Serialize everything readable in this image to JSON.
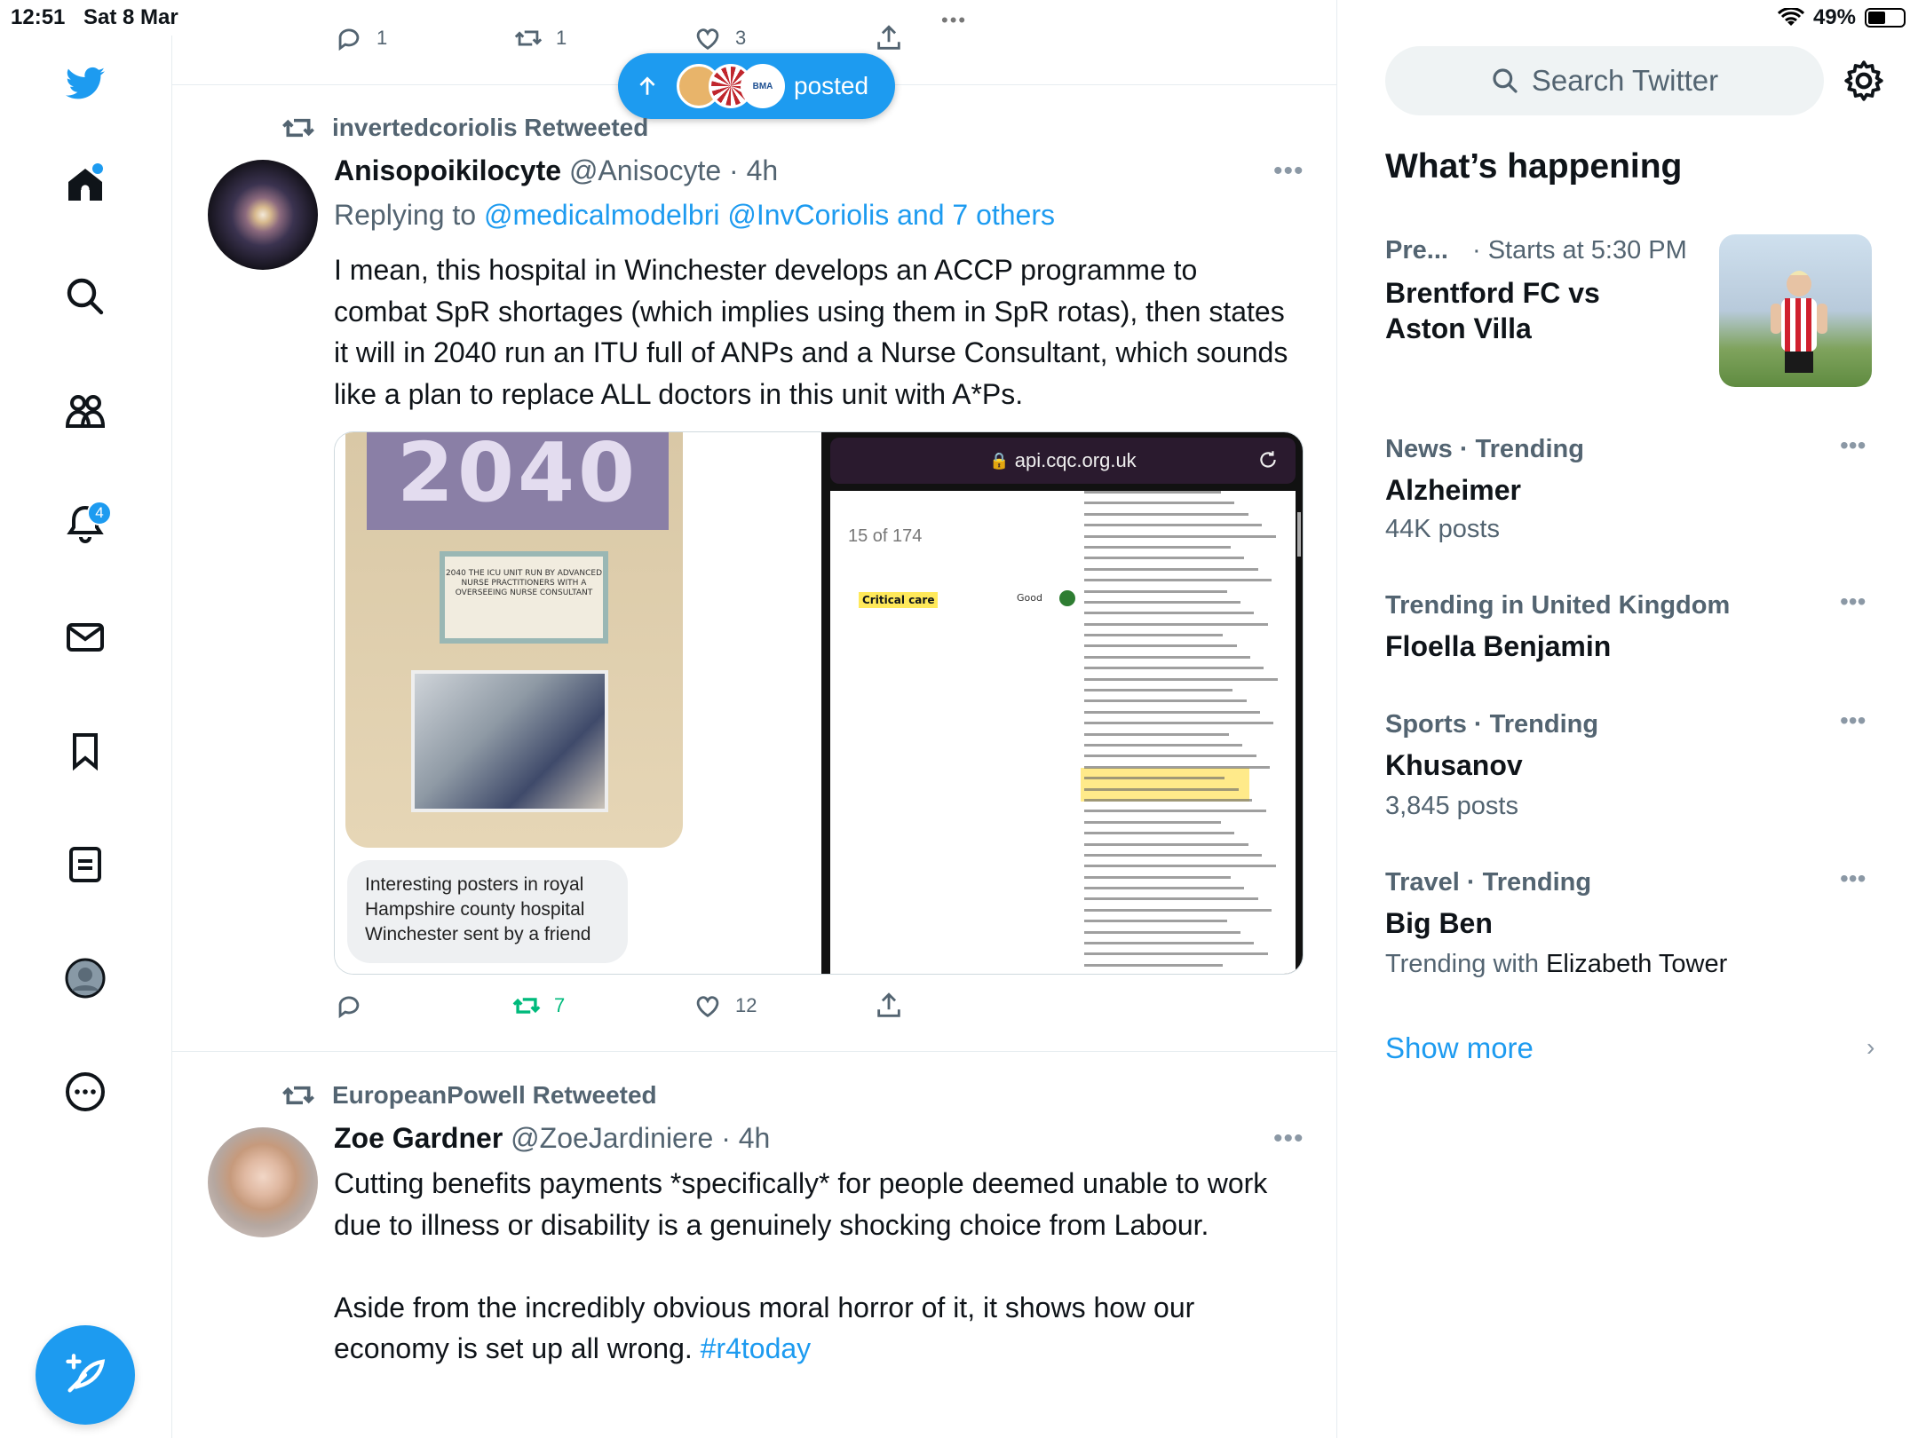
{
  "status_bar": {
    "time": "12:51",
    "date": "Sat 8 Mar",
    "battery": "49%"
  },
  "nav": {
    "notifications_badge": "4",
    "icons": [
      "twitter-logo-icon",
      "home-icon",
      "search-icon",
      "communities-icon",
      "bell-icon",
      "mail-icon",
      "bookmark-icon",
      "lists-icon",
      "profile-icon",
      "more-icon"
    ]
  },
  "timeline": {
    "prev_tweet_counts": {
      "replies": "1",
      "retweets": "1",
      "likes": "3"
    },
    "new_posts_pill": {
      "label": "posted",
      "avatar_badge": "BMA"
    },
    "tweet1": {
      "retweeted_by": "invertedcoriolis Retweeted",
      "name": "Anisopoikilocyte",
      "handle": "@Anisocyte",
      "time": "· 4h",
      "replying_prefix": "Replying to",
      "replying_links": "@medicalmodelbri @InvCoriolis and 7 others",
      "text": "I mean, this hospital in Winchester develops an ACCP programme to combat SpR shortages (which implies using them in SpR rotas), then states it will in 2040 run an ITU full of ANPs and a Nurse Consultant, which sounds like a plan to replace ALL doctors in this unit with A*Ps.",
      "media": {
        "poster_year": "2040",
        "poster_card_text": "2040 THE ICU UNIT RUN BY ADVANCED NURSE PRACTITIONERS WITH A OVERSEEING NURSE CONSULTANT",
        "caption": "Interesting posters in royal Hampshire county hospital Winchester sent by a friend",
        "url": "api.cqc.org.uk",
        "page_counter": "15 of 174",
        "doc_label": "Critical care",
        "doc_rating": "Good"
      },
      "counts": {
        "replies": "",
        "retweets": "7",
        "likes": "12"
      }
    },
    "tweet2": {
      "retweeted_by": "EuropeanPowell Retweeted",
      "name": "Zoe Gardner",
      "handle": "@ZoeJardiniere",
      "time": "· 4h",
      "text_p1": "Cutting benefits payments *specifically* for people deemed unable to work due to illness or disability is a genuinely shocking choice from Labour.",
      "text_p2": "Aside from the incredibly obvious moral horror of it, it shows how our economy is set up all wrong. ",
      "hashtag": "#r4today"
    }
  },
  "sidebar": {
    "search_placeholder": "Search Twitter",
    "whats_happening": "What’s happening",
    "trends": [
      {
        "meta": "Pre...",
        "meta2": "· Starts at 5:30 PM",
        "title_line1": "Brentford FC vs",
        "title_line2": "Aston Villa"
      },
      {
        "meta": "News · Trending",
        "title": "Alzheimer",
        "sub": "44K posts"
      },
      {
        "meta": "Trending in United Kingdom",
        "title": "Floella Benjamin"
      },
      {
        "meta": "Sports · Trending",
        "title": "Khusanov",
        "sub": "3,845 posts"
      },
      {
        "meta": "Travel · Trending",
        "title": "Big Ben",
        "sub_prefix": "Trending with ",
        "sub_strong": "Elizabeth Tower"
      }
    ],
    "show_more": "Show more"
  }
}
